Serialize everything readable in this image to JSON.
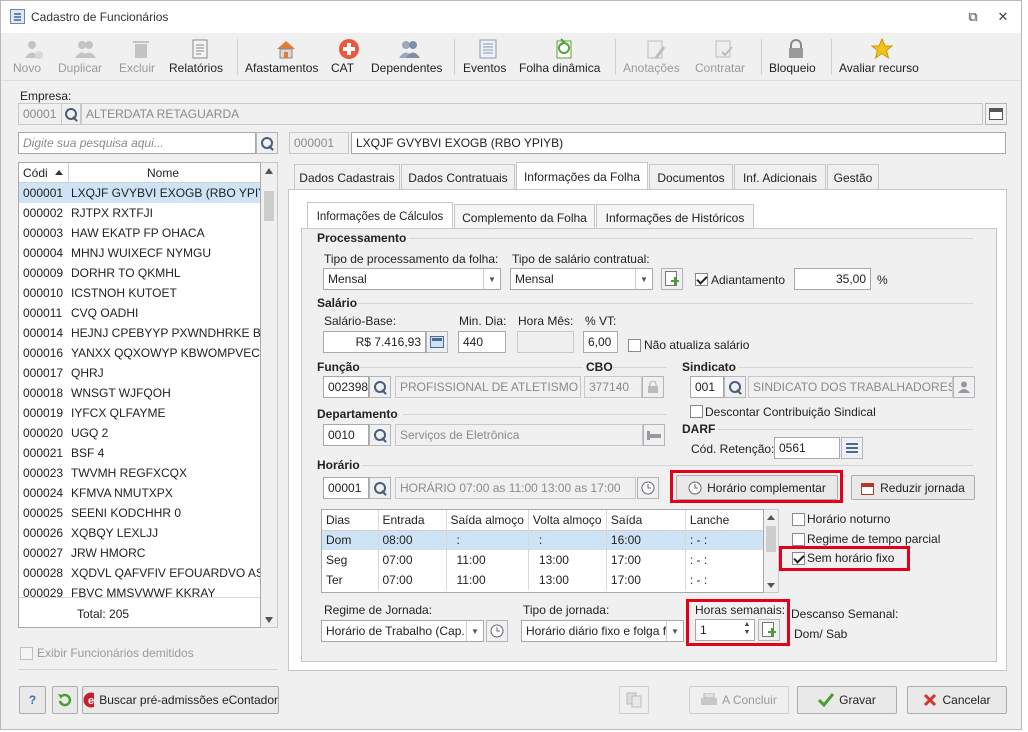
{
  "window": {
    "title": "Cadastro de Funcionários",
    "minimize_glyph": "⧉",
    "close_glyph": "✕"
  },
  "toolbar": [
    {
      "key": "novo",
      "label": "Novo",
      "enabled": false,
      "icon": "new-person-icon"
    },
    {
      "key": "duplicar",
      "label": "Duplicar",
      "enabled": false,
      "icon": "duplicate-icon"
    },
    {
      "key": "excluir",
      "label": "Excluir",
      "enabled": false,
      "icon": "trash-icon"
    },
    {
      "key": "relatorios",
      "label": "Relatórios",
      "enabled": true,
      "icon": "report-icon"
    },
    {
      "key": "afastamentos",
      "label": "Afastamentos",
      "enabled": true,
      "icon": "house-icon"
    },
    {
      "key": "cat",
      "label": "CAT",
      "enabled": true,
      "icon": "medical-cross-icon"
    },
    {
      "key": "dependentes",
      "label": "Dependentes",
      "enabled": true,
      "icon": "people-icon"
    },
    {
      "key": "eventos",
      "label": "Eventos",
      "enabled": true,
      "icon": "list-icon"
    },
    {
      "key": "folha",
      "label": "Folha dinâmica",
      "enabled": true,
      "icon": "green-sheet-icon"
    },
    {
      "key": "anotacoes",
      "label": "Anotações",
      "enabled": false,
      "icon": "notes-icon"
    },
    {
      "key": "contratar",
      "label": "Contratar",
      "enabled": false,
      "icon": "contract-icon"
    },
    {
      "key": "bloqueio",
      "label": "Bloqueio",
      "enabled": true,
      "icon": "padlock-icon"
    },
    {
      "key": "avaliar",
      "label": "Avaliar recurso",
      "enabled": true,
      "icon": "star-icon"
    }
  ],
  "empresa": {
    "label": "Empresa:",
    "code": "00001",
    "name": "ALTERDATA RETAGUARDA"
  },
  "search": {
    "placeholder": "Digite sua pesquisa aqui..."
  },
  "selected": {
    "code": "000001",
    "name": "LXQJF GVYBVI EXOGB (RBO YPIYB)"
  },
  "list": {
    "headers": {
      "code": "Códi",
      "name": "Nome"
    },
    "rows": [
      [
        "000001",
        "LXQJF GVYBVI EXOGB (RBO YPIYB)"
      ],
      [
        "000002",
        "RJTPX RXTFJI"
      ],
      [
        "000003",
        "HAW EKATP FP OHACA"
      ],
      [
        "000004",
        "MHNJ WUIXECF NYMGU"
      ],
      [
        "000009",
        "DORHR TO QKMHL"
      ],
      [
        "000010",
        "ICSTNOH KUTOET"
      ],
      [
        "000011",
        "CVQ OADHI"
      ],
      [
        "000014",
        "HEJNJ CPEBYYP PXWNDHRKE BTB J"
      ],
      [
        "000016",
        "YANXX QQXOWYP KBWOMPVEC A"
      ],
      [
        "000017",
        "QHRJ"
      ],
      [
        "000018",
        "WNSGT WJFQOH"
      ],
      [
        "000019",
        "IYFCX QLFAYME"
      ],
      [
        "000020",
        "UGQ 2"
      ],
      [
        "000021",
        "BSF 4"
      ],
      [
        "000023",
        "TWVMH REGFXCQX"
      ],
      [
        "000024",
        "KFMVA NMUTXPX"
      ],
      [
        "000025",
        "SEENI KODCHHR 0"
      ],
      [
        "000026",
        "XQBQY LEXLJJ"
      ],
      [
        "000027",
        "JRW HMORC"
      ],
      [
        "000028",
        "XQDVL QAFVFIV EFOUARDVO AST U"
      ],
      [
        "000029",
        "FBVC MMSVWWF KKRAY"
      ]
    ],
    "total": "Total: 205",
    "show_dismissed": "Exibir Funcionários demitidos"
  },
  "tabs": [
    "Dados Cadastrais",
    "Dados Contratuais",
    "Informações da Folha",
    "Documentos",
    "Inf. Adicionais",
    "Gestão"
  ],
  "subtabs": [
    "Informações de Cálculos",
    "Complemento da Folha",
    "Informações de Históricos"
  ],
  "proc": {
    "section": "Processamento",
    "tipo_label": "Tipo de processamento da folha:",
    "tipo_value": "Mensal",
    "sal_label": "Tipo de salário contratual:",
    "sal_value": "Mensal",
    "adiant_label": "Adiantamento",
    "adiant_value": "35,00",
    "pct": "%"
  },
  "salario": {
    "section": "Salário",
    "base_label": "Salário-Base:",
    "base_value": "R$ 7.416,93",
    "min_label": "Min. Dia:",
    "min_value": "440",
    "hora_label": "Hora Mês:",
    "hora_value": "",
    "vt_label": "% VT:",
    "vt_value": "6,00",
    "nao_atualiza": "Não atualiza salário"
  },
  "funcao": {
    "section": "Função",
    "code": "002398",
    "name": "PROFISSIONAL DE ATLETISMO",
    "cbo_label": "CBO",
    "cbo": "377140"
  },
  "sindicato": {
    "section": "Sindicato",
    "code": "001",
    "name": "SINDICATO DOS TRABALHADORES DE",
    "descontar": "Descontar Contribuição Sindical"
  },
  "depto": {
    "section": "Departamento",
    "code": "0010",
    "name": "Serviços de Eletrônica"
  },
  "darf": {
    "section": "DARF",
    "label": "Cód. Retenção:",
    "value": "0561"
  },
  "horario": {
    "section": "Horário",
    "code": "00001",
    "desc": "HORÁRIO 07:00 as 11:00  13:00 as 17:00",
    "complementar": "Horário complementar",
    "reduzir": "Reduzir jornada",
    "table": {
      "headers": [
        "Dias",
        "Entrada",
        "Saída almoço",
        "Volta almoço",
        "Saída",
        "Lanche"
      ],
      "rows": [
        [
          "Dom",
          "08:00",
          ":",
          ":",
          "16:00",
          ":  -  :"
        ],
        [
          "Seg",
          "07:00",
          "11:00",
          "13:00",
          "17:00",
          ":  -  :"
        ],
        [
          "Ter",
          "07:00",
          "11:00",
          "13:00",
          "17:00",
          ":  -  :"
        ]
      ]
    },
    "noturno": "Horário noturno",
    "parcial": "Regime de tempo parcial",
    "sem_fixo": "Sem horário fixo"
  },
  "jornada": {
    "regime_label": "Regime de Jornada:",
    "regime_value": "Horário de Trabalho (Cap.",
    "tipo_label": "Tipo de jornada:",
    "tipo_value": "Horário diário fixo e folga f",
    "horas_label": "Horas semanais:",
    "horas_value": "1",
    "descanso_label": "Descanso Semanal:",
    "descanso_value": "Dom/ Sab"
  },
  "bottom": {
    "help": "?",
    "buscar": "Buscar pré-admissões eContador",
    "concluir": "A Concluir",
    "gravar": "Gravar",
    "cancelar": "Cancelar"
  },
  "colors": {
    "highlight": "#e2001a",
    "selection": "#cfe3f7",
    "accent": "#3d6fb3"
  }
}
